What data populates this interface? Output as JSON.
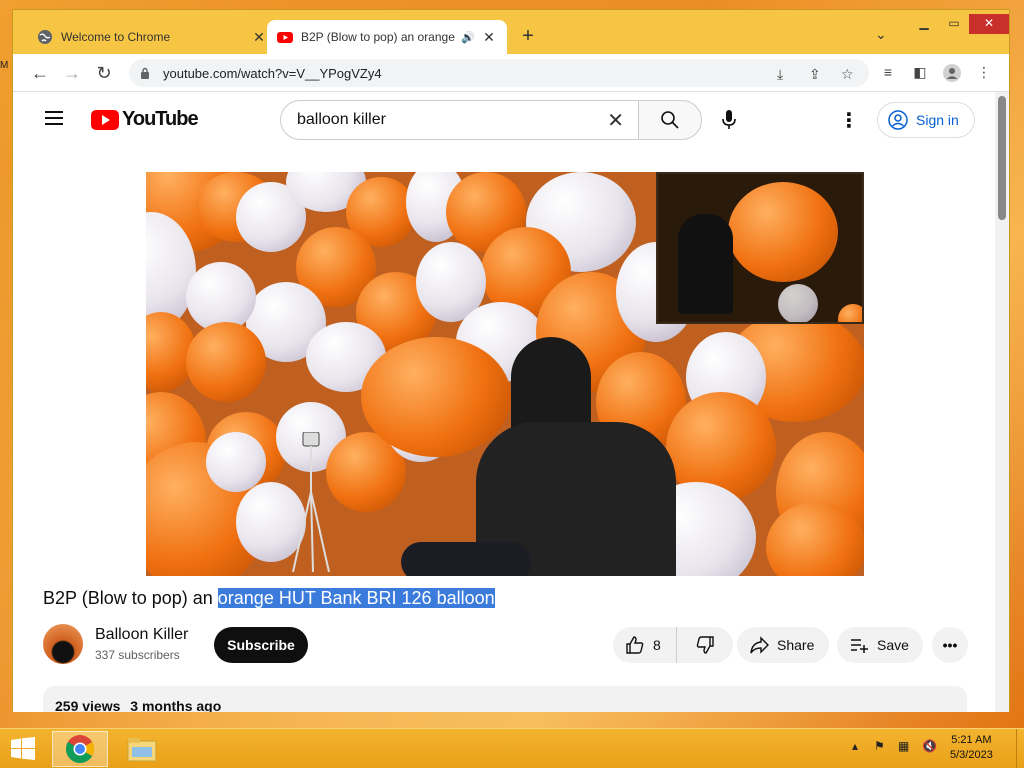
{
  "desktop": {
    "label": "M"
  },
  "browser": {
    "tabs": [
      {
        "title": "Welcome to Chrome",
        "active": false
      },
      {
        "title": "B2P (Blow to pop) an orange",
        "active": true
      }
    ],
    "new_tab_label": "+",
    "address": "youtube.com/watch?v=V__YPogVZy4"
  },
  "youtube": {
    "logo_text": "YouTube",
    "search_value": "balloon killer",
    "sign_in_label": "Sign in",
    "video": {
      "title_plain": "B2P (Blow to pop) an ",
      "title_highlighted": "orange HUT Bank BRI 126 balloon"
    },
    "channel": {
      "name": "Balloon Killer",
      "subscribers": "337 subscribers",
      "subscribe_label": "Subscribe"
    },
    "actions": {
      "like_count": "8",
      "share_label": "Share",
      "save_label": "Save"
    },
    "description": {
      "views": "259 views",
      "age": "3 months ago"
    }
  },
  "taskbar": {
    "time": "5:21 AM",
    "date": "5/3/2023"
  },
  "colors": {
    "youtube_red": "#ff0000",
    "link_blue": "#065fd4",
    "window_frame": "#f7c544",
    "selection": "#3a7bdc"
  }
}
